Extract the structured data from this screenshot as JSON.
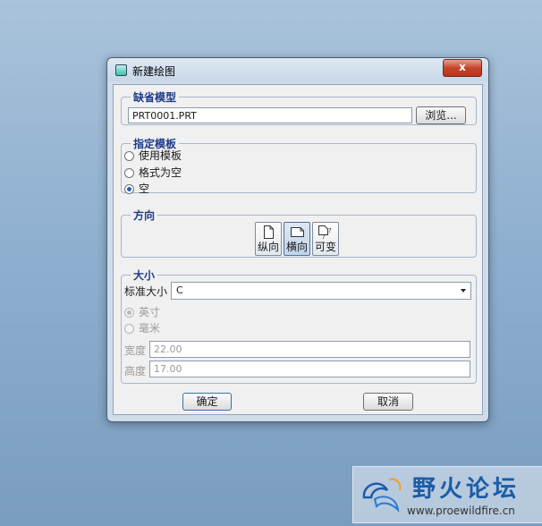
{
  "window": {
    "title": "新建绘图",
    "close_label": "x"
  },
  "default_model": {
    "legend": "缺省模型",
    "value": "PRT0001.PRT",
    "browse_label": "浏览..."
  },
  "template": {
    "legend": "指定模板",
    "options": [
      "使用模板",
      "格式为空",
      "空"
    ],
    "selected": "空"
  },
  "orientation": {
    "legend": "方向",
    "options": [
      "纵向",
      "横向",
      "可变"
    ],
    "selected": "横向"
  },
  "size": {
    "legend": "大小",
    "standard_label": "标准大小",
    "standard_value": "C",
    "units": [
      "英寸",
      "毫米"
    ],
    "units_selected": "英寸",
    "width_label": "宽度",
    "width_value": "22.00",
    "height_label": "高度",
    "height_value": "17.00"
  },
  "buttons": {
    "ok": "确定",
    "cancel": "取消"
  },
  "watermark": {
    "title": "野火论坛",
    "url": "www.proewildfire.cn"
  },
  "colors": {
    "legend": "#1e3a8a",
    "close": "#c7452c",
    "watermark": "#1a5ca8"
  }
}
